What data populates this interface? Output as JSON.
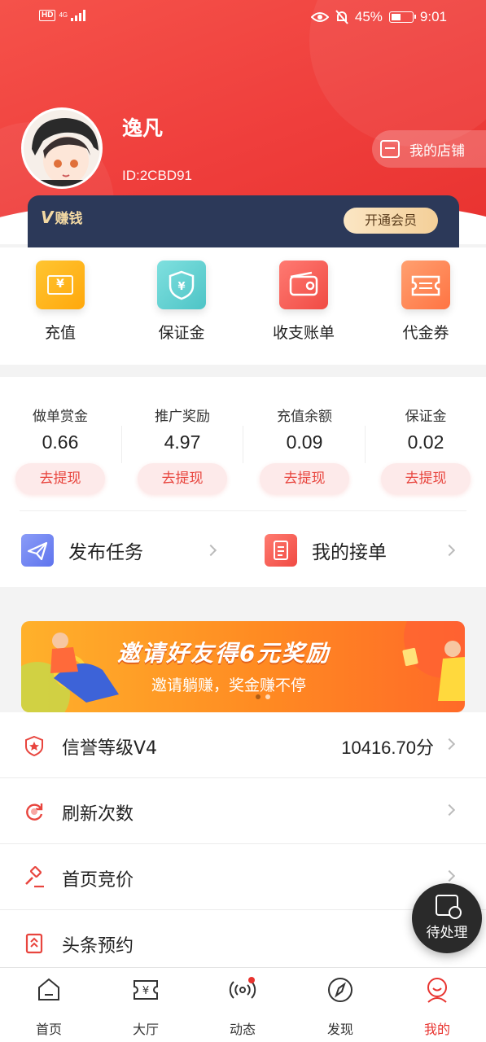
{
  "status_bar": {
    "hd": "HD",
    "network": "4G",
    "battery": "45%",
    "time": "9:01"
  },
  "profile": {
    "name": "逸凡",
    "id": "ID:2CBD91",
    "shop_button": "我的店铺"
  },
  "vip": {
    "logo_letter": "V",
    "logo_text": "赚钱",
    "button": "开通会员"
  },
  "quick_actions": [
    {
      "label": "充值",
      "color": "#ffb414",
      "icon": "recharge-icon"
    },
    {
      "label": "保证金",
      "color": "#5fd0d0",
      "icon": "deposit-shield-icon"
    },
    {
      "label": "收支账单",
      "color": "#f45f5a",
      "icon": "wallet-icon"
    },
    {
      "label": "代金券",
      "color": "#ff8a5c",
      "icon": "coupon-icon"
    }
  ],
  "balances": [
    {
      "title": "做单赏金",
      "value": "0.66",
      "action": "去提现"
    },
    {
      "title": "推广奖励",
      "value": "4.97",
      "action": "去提现"
    },
    {
      "title": "充值余额",
      "value": "0.09",
      "action": "去提现"
    },
    {
      "title": "保证金",
      "value": "0.02",
      "action": "去提现"
    }
  ],
  "tasks": {
    "publish": "发布任务",
    "my_orders": "我的接单"
  },
  "banner": {
    "title": "邀请好友得6元奖励",
    "subtitle": "邀请躺赚，奖金赚不停"
  },
  "menu": [
    {
      "label": "信誉等级V4",
      "value": "10416.70分",
      "icon": "badge-star-icon"
    },
    {
      "label": "刷新次数",
      "value": "",
      "icon": "refresh-icon"
    },
    {
      "label": "首页竞价",
      "value": "",
      "icon": "auction-hammer-icon"
    },
    {
      "label": "头条预约",
      "value": "",
      "icon": "headline-icon"
    }
  ],
  "fab": {
    "label": "待处理"
  },
  "tabs": [
    {
      "label": "首页",
      "icon": "home-icon"
    },
    {
      "label": "大厅",
      "icon": "hall-ticket-icon"
    },
    {
      "label": "动态",
      "icon": "broadcast-icon"
    },
    {
      "label": "发现",
      "icon": "compass-icon"
    },
    {
      "label": "我的",
      "icon": "profile-face-icon",
      "active": true
    }
  ],
  "colors": {
    "brand_red": "#ef3e3c",
    "vip_bar": "#2c3959",
    "accent_text": "#e8453e"
  }
}
